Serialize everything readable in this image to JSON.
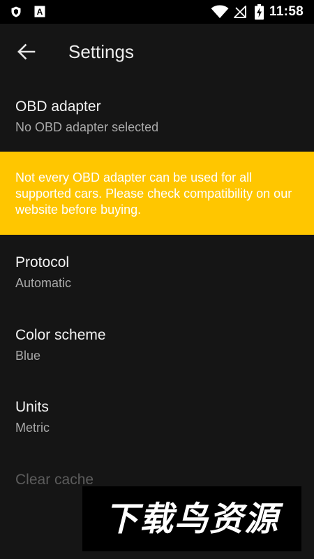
{
  "status_bar": {
    "time": "11:58",
    "left_icons": [
      "shield-icon",
      "a-badge-icon"
    ],
    "right_icons": [
      "wifi-icon",
      "no-signal-icon",
      "battery-charging-icon"
    ],
    "a_badge_label": "A"
  },
  "toolbar": {
    "title": "Settings",
    "back_icon": "arrow-left-icon"
  },
  "preferences": {
    "obd_adapter": {
      "title": "OBD adapter",
      "summary": "No OBD adapter selected"
    },
    "notice": "Not every OBD adapter can be used for all supported cars. Please check compatibility on our website before buying.",
    "protocol": {
      "title": "Protocol",
      "summary": "Automatic"
    },
    "color_scheme": {
      "title": "Color scheme",
      "summary": "Blue"
    },
    "units": {
      "title": "Units",
      "summary": "Metric"
    },
    "clear_cache": {
      "title": "Clear cache"
    }
  },
  "watermark": {
    "text": "下载鸟资源"
  },
  "colors": {
    "background": "#151515",
    "status_bar": "#000000",
    "notice_background": "#ffc600",
    "title_text": "#f2f2f2",
    "summary_text": "#a9a9a9",
    "disabled_text": "#5c5c5c"
  }
}
